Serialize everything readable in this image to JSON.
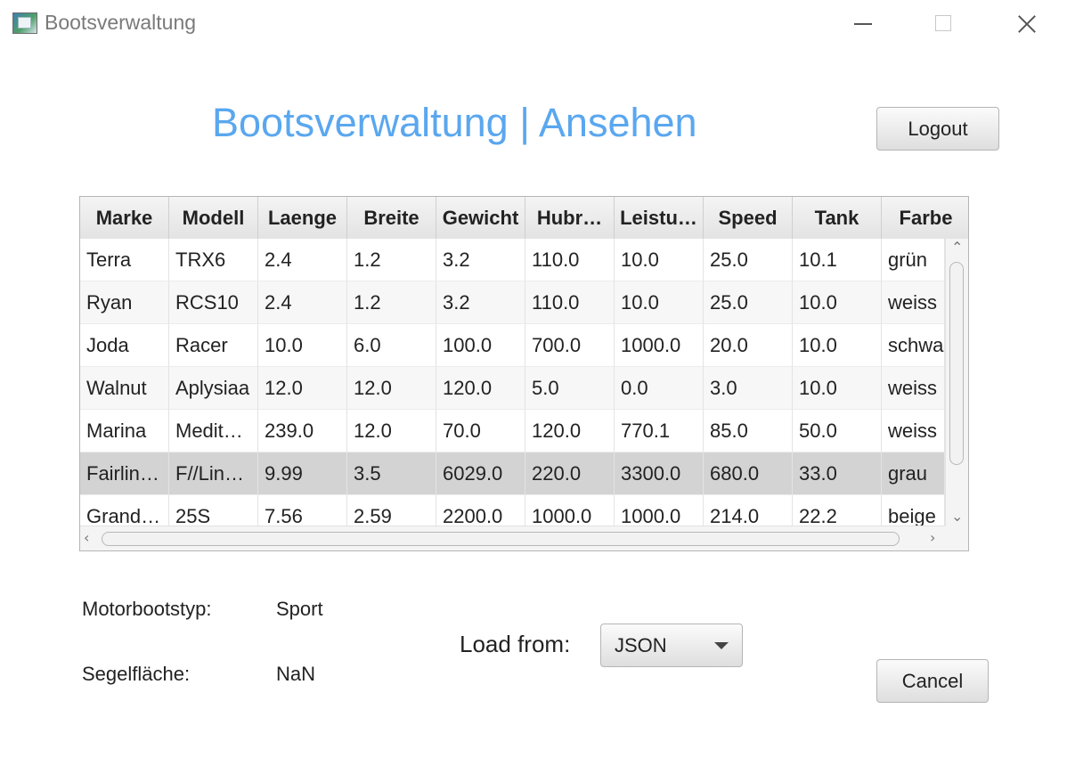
{
  "window": {
    "title": "Bootsverwaltung"
  },
  "header": {
    "title": "Bootsverwaltung | Ansehen",
    "logout_label": "Logout"
  },
  "table": {
    "columns": [
      "Marke",
      "Modell",
      "Laenge",
      "Breite",
      "Gewicht",
      "Hubr…",
      "Leistu…",
      "Speed",
      "Tank",
      "Farbe"
    ],
    "rows": [
      [
        "Terra",
        "TRX6",
        "2.4",
        "1.2",
        "3.2",
        "110.0",
        "10.0",
        "25.0",
        "10.1",
        "grün"
      ],
      [
        "Ryan",
        "RCS10",
        "2.4",
        "1.2",
        "3.2",
        "110.0",
        "10.0",
        "25.0",
        "10.0",
        "weiss"
      ],
      [
        "Joda",
        "Racer",
        "10.0",
        "6.0",
        "100.0",
        "700.0",
        "1000.0",
        "20.0",
        "10.0",
        "schwa"
      ],
      [
        "Walnut",
        "Aplysiaa",
        "12.0",
        "12.0",
        "120.0",
        "5.0",
        "0.0",
        "3.0",
        "10.0",
        "weiss"
      ],
      [
        "Marina",
        "Medit…",
        "239.0",
        "12.0",
        "70.0",
        "120.0",
        "770.1",
        "85.0",
        "50.0",
        "weiss"
      ],
      [
        "Fairlin…",
        "F//Lin…",
        "9.99",
        "3.5",
        "6029.0",
        "220.0",
        "3300.0",
        "680.0",
        "33.0",
        "grau"
      ],
      [
        "Grand…",
        "25S",
        "7.56",
        "2.59",
        "2200.0",
        "1000.0",
        "1000.0",
        "214.0",
        "22.2",
        "beige"
      ]
    ],
    "selected_row": 5
  },
  "details": {
    "motorbootstyp_label": "Motorbootstyp:",
    "motorbootstyp_value": "Sport",
    "segelflaeche_label": "Segelfläche:",
    "segelflaeche_value": "NaN"
  },
  "load": {
    "label": "Load from:",
    "selected": "JSON"
  },
  "footer": {
    "cancel_label": "Cancel"
  },
  "colors": {
    "heading": "#5aa7ef",
    "selected_row": "#d3d3d3"
  }
}
